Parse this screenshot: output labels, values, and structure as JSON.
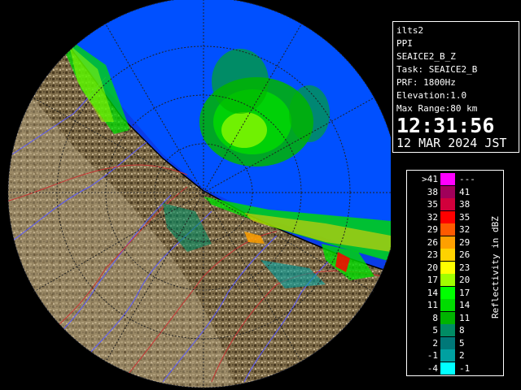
{
  "info": {
    "site": "ilts2",
    "product": "PPI",
    "product_name": "SEAICE2_B_Z",
    "task": "Task: SEAICE2_B",
    "prf": "PRF: 1800Hz",
    "elevation": "Elevation:1.0",
    "max_range": "Max Range:80 km",
    "time": "12:31:56",
    "date": "12 MAR 2024 JST"
  },
  "legend": {
    "unit_label": "Reflectivity in dBZ",
    "rows": [
      {
        "lo": ">41",
        "hi": "---",
        "color": "#ff00ff"
      },
      {
        "lo": "38",
        "hi": "41",
        "color": "#a0005a"
      },
      {
        "lo": "35",
        "hi": "38",
        "color": "#d2003c"
      },
      {
        "lo": "32",
        "hi": "35",
        "color": "#ff0000"
      },
      {
        "lo": "29",
        "hi": "32",
        "color": "#ff5a00"
      },
      {
        "lo": "26",
        "hi": "29",
        "color": "#ffa000"
      },
      {
        "lo": "23",
        "hi": "26",
        "color": "#ffd200"
      },
      {
        "lo": "20",
        "hi": "23",
        "color": "#ffff00"
      },
      {
        "lo": "17",
        "hi": "20",
        "color": "#a0ff00"
      },
      {
        "lo": "14",
        "hi": "17",
        "color": "#00ff00"
      },
      {
        "lo": "11",
        "hi": "14",
        "color": "#00dc00"
      },
      {
        "lo": "8",
        "hi": "11",
        "color": "#00b400"
      },
      {
        "lo": "5",
        "hi": "8",
        "color": "#008c64"
      },
      {
        "lo": "2",
        "hi": "5",
        "color": "#007878"
      },
      {
        "lo": "-1",
        "hi": "2",
        "color": "#00a0a0"
      },
      {
        "lo": "-4",
        "hi": "-1",
        "color": "#00ffff"
      }
    ]
  },
  "colors": {
    "sea_echo": "#0050ff",
    "land": "#7a6a48",
    "range_ring": "#202020",
    "coastline": "#000000",
    "river": "#5a5aff",
    "boundary": "#c83232"
  }
}
